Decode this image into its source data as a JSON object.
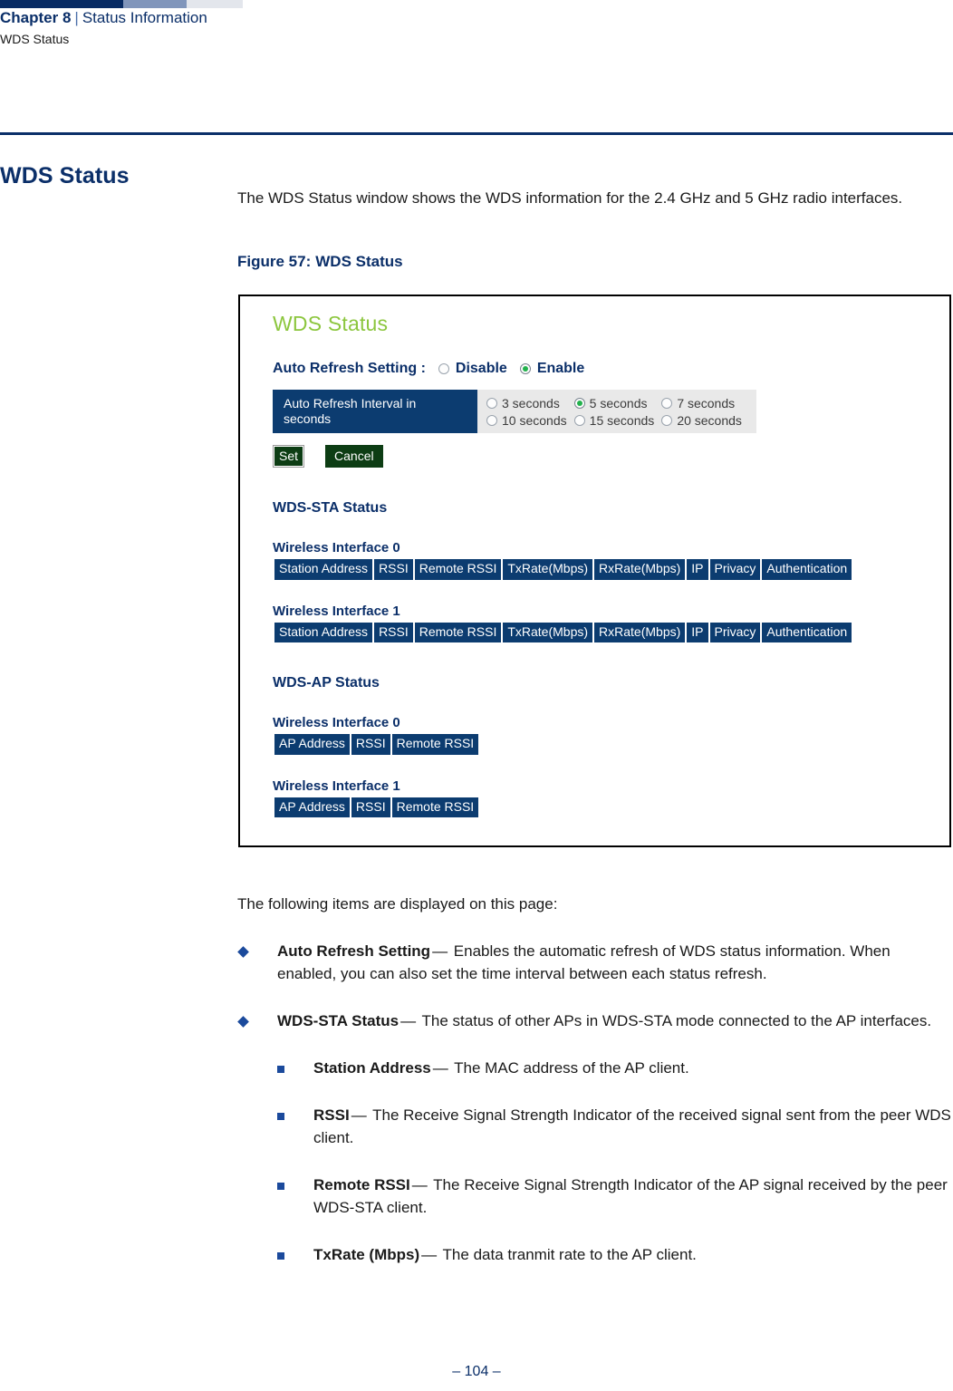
{
  "running_header": {
    "chapter": "Chapter 8",
    "separator": "|",
    "section": "Status Information",
    "subsection": "WDS Status"
  },
  "page_title": "WDS Status",
  "intro_paragraph": "The WDS Status window shows the WDS information for the 2.4 GHz and 5 GHz radio interfaces.",
  "figure": {
    "caption_number": "Figure 57:",
    "caption_text": "WDS Status",
    "screenshot": {
      "title": "WDS Status",
      "auto_refresh": {
        "label": "Auto Refresh Setting :",
        "options": [
          {
            "label": "Disable",
            "selected": false
          },
          {
            "label": "Enable",
            "selected": true
          }
        ]
      },
      "interval": {
        "label": "Auto Refresh Interval in seconds",
        "options": [
          {
            "label": "3 seconds",
            "selected": false
          },
          {
            "label": "5 seconds",
            "selected": true
          },
          {
            "label": "7 seconds",
            "selected": false
          },
          {
            "label": "10 seconds",
            "selected": false
          },
          {
            "label": "15 seconds",
            "selected": false
          },
          {
            "label": "20 seconds",
            "selected": false
          }
        ]
      },
      "buttons": {
        "set": "Set",
        "cancel": "Cancel"
      },
      "sta_section": {
        "heading": "WDS-STA Status",
        "columns": [
          "Station Address",
          "RSSI",
          "Remote RSSI",
          "TxRate(Mbps)",
          "RxRate(Mbps)",
          "IP",
          "Privacy",
          "Authentication"
        ],
        "interfaces": [
          "Wireless Interface 0",
          "Wireless Interface 1"
        ]
      },
      "ap_section": {
        "heading": "WDS-AP Status",
        "columns": [
          "AP Address",
          "RSSI",
          "Remote RSSI"
        ],
        "interfaces": [
          "Wireless Interface 0",
          "Wireless Interface 1"
        ]
      },
      "colors": {
        "title_green": "#8cc63e",
        "header_blue": "#0c3c70",
        "button_green": "#0d3d14",
        "radio_green": "#22b14c"
      }
    }
  },
  "list_intro": "The following items are displayed on this page:",
  "items": [
    {
      "term": "Auto Refresh Setting",
      "dash": "—",
      "desc": "Enables the automatic refresh of WDS status information. When enabled, you can also set the time interval between each status refresh."
    },
    {
      "term": "WDS-STA Status",
      "dash": "—",
      "desc": "The status of other APs in WDS-STA mode connected to the AP interfaces.",
      "subitems": [
        {
          "term": "Station Address",
          "dash": "—",
          "desc": "The MAC address of the AP client."
        },
        {
          "term": "RSSI",
          "dash": "—",
          "desc": "The Receive Signal Strength Indicator of the received signal sent from the peer WDS client."
        },
        {
          "term": "Remote RSSI",
          "dash": "—",
          "desc": "The Receive Signal Strength Indicator of the AP signal received by the peer WDS-STA client."
        },
        {
          "term": "TxRate (Mbps)",
          "dash": "—",
          "desc": "The data tranmit rate to the AP client."
        }
      ]
    }
  ],
  "footer": "–  104  –"
}
